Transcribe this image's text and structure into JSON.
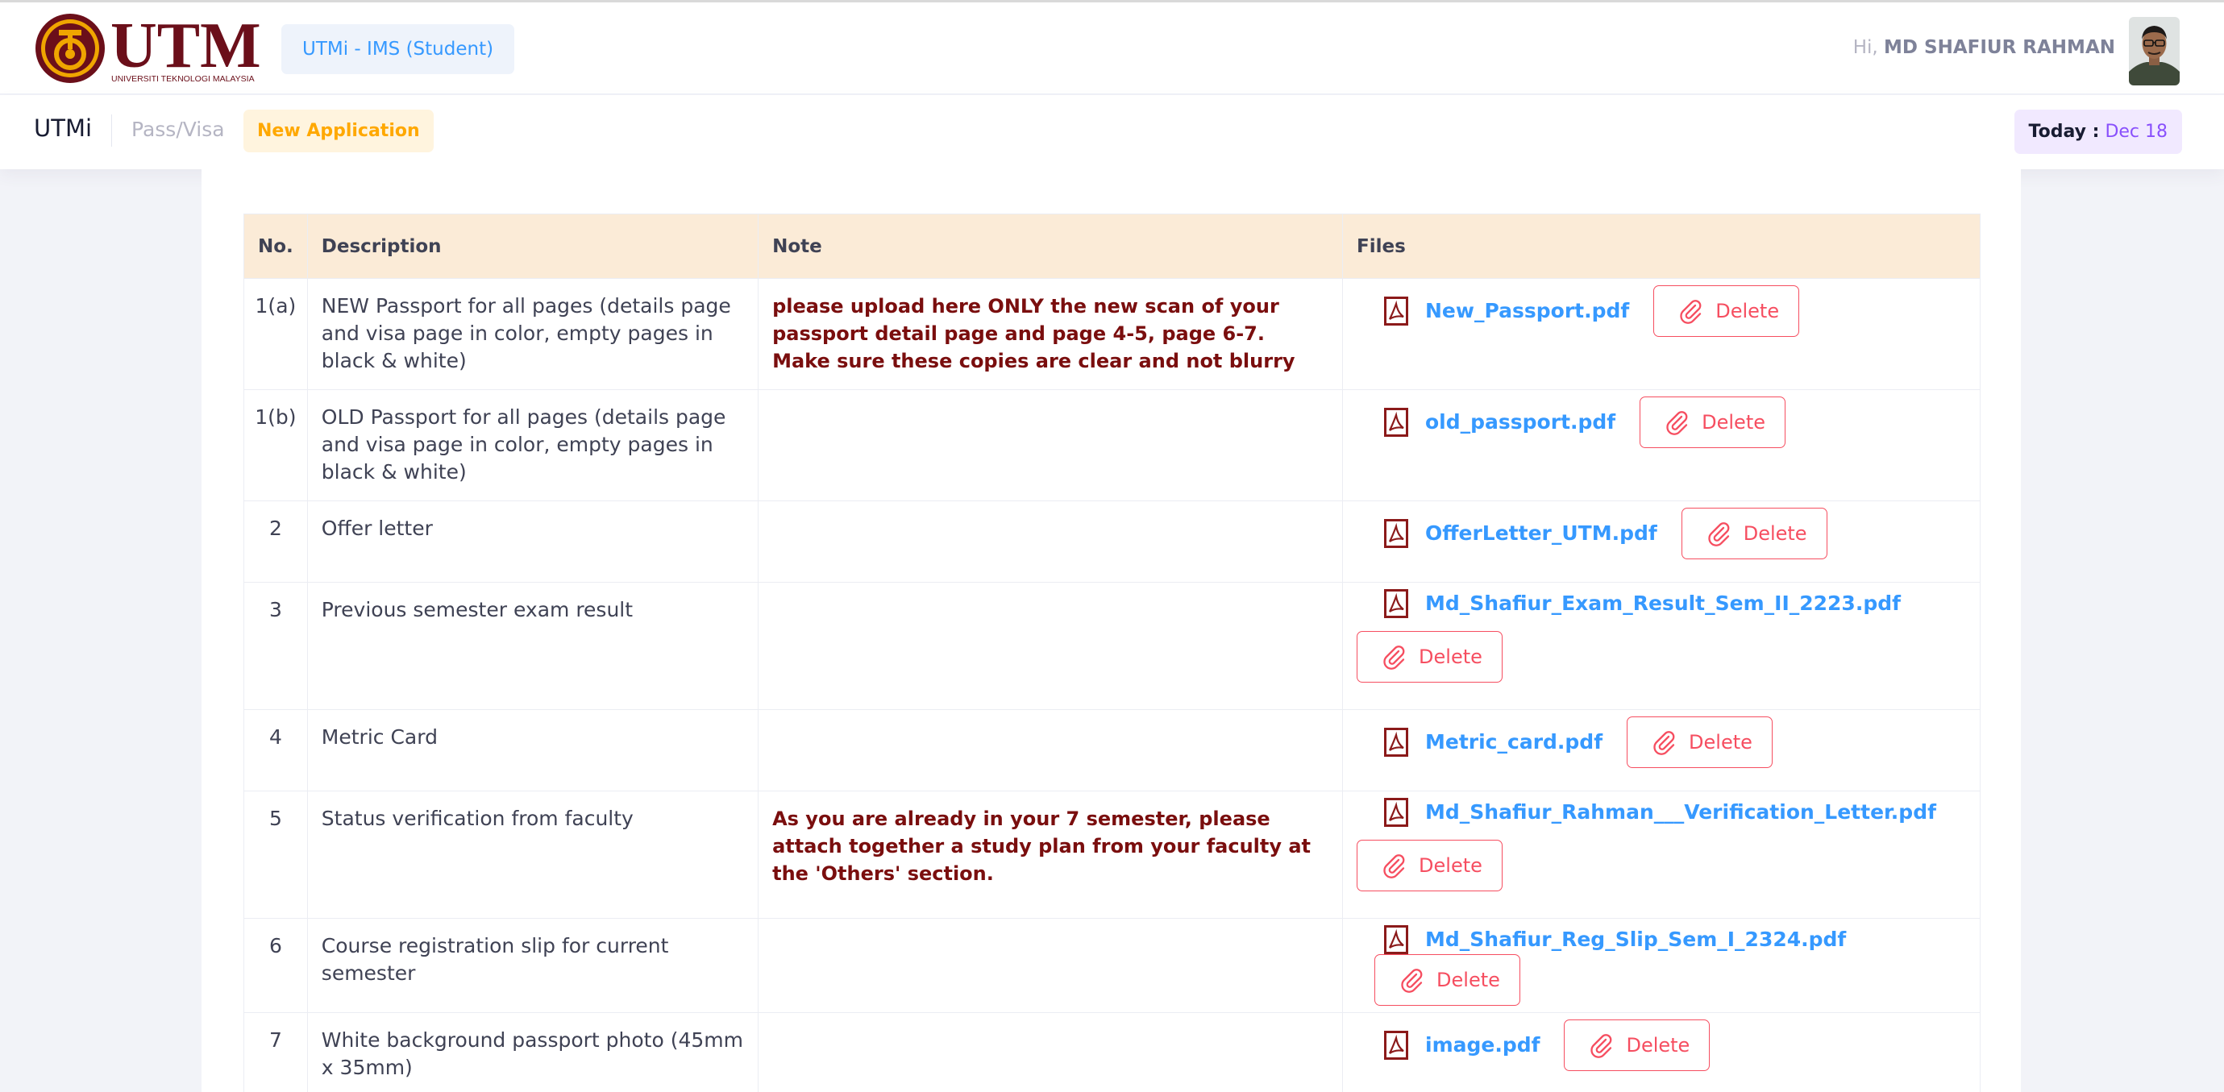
{
  "header": {
    "logo_text": "UTM",
    "logo_subtext": "UNIVERSITI TEKNOLOGI MALAYSIA",
    "app_name": "UTMi - IMS (Student)",
    "greeting": "Hi,",
    "user_name": "MD SHAFIUR RAHMAN"
  },
  "subheader": {
    "brand": "UTMi",
    "breadcrumb": "Pass/Visa",
    "badge": "New Application",
    "today_label": "Today :",
    "today_value": "Dec 18"
  },
  "table": {
    "columns": [
      "No.",
      "Description",
      "Note",
      "Files"
    ],
    "delete_label": "Delete",
    "rows": [
      {
        "no": "1(a)",
        "description": "NEW Passport for all pages (details page and visa page in color, empty pages in black & white)",
        "note": "please upload here ONLY the new scan of your passport detail page and page 4-5, page 6-7. Make sure these copies are clear and not blurry",
        "file": "New_Passport.pdf"
      },
      {
        "no": "1(b)",
        "description": "OLD Passport for all pages (details page and visa page in color, empty pages in black & white)",
        "note": "",
        "file": "old_passport.pdf"
      },
      {
        "no": "2",
        "description": "Offer letter",
        "note": "",
        "file": "OfferLetter_UTM.pdf"
      },
      {
        "no": "3",
        "description": "Previous semester exam result",
        "note": "",
        "file": "Md_Shafiur_Exam_Result_Sem_II_2223.pdf"
      },
      {
        "no": "4",
        "description": "Metric Card",
        "note": "",
        "file": "Metric_card.pdf"
      },
      {
        "no": "5",
        "description": "Status verification from faculty",
        "note": "As you are already in your 7 semester, please attach together a study plan from your faculty at the 'Others' section.",
        "file": "Md_Shafiur_Rahman___Verification_Letter.pdf"
      },
      {
        "no": "6",
        "description": "Course registration slip for current semester",
        "note": "",
        "file": "Md_Shafiur_Reg_Slip_Sem_I_2324.pdf"
      },
      {
        "no": "7",
        "description": "White background passport photo (45mm x 35mm)",
        "note": "",
        "file": "image.pdf"
      }
    ]
  },
  "colors": {
    "accent_blue": "#3699ff",
    "danger": "#f64e60",
    "note_red": "#7a0e0e",
    "header_row": "#fbebd7",
    "utm_maroon": "#6b0f1a",
    "utm_gold": "#f0a500"
  }
}
